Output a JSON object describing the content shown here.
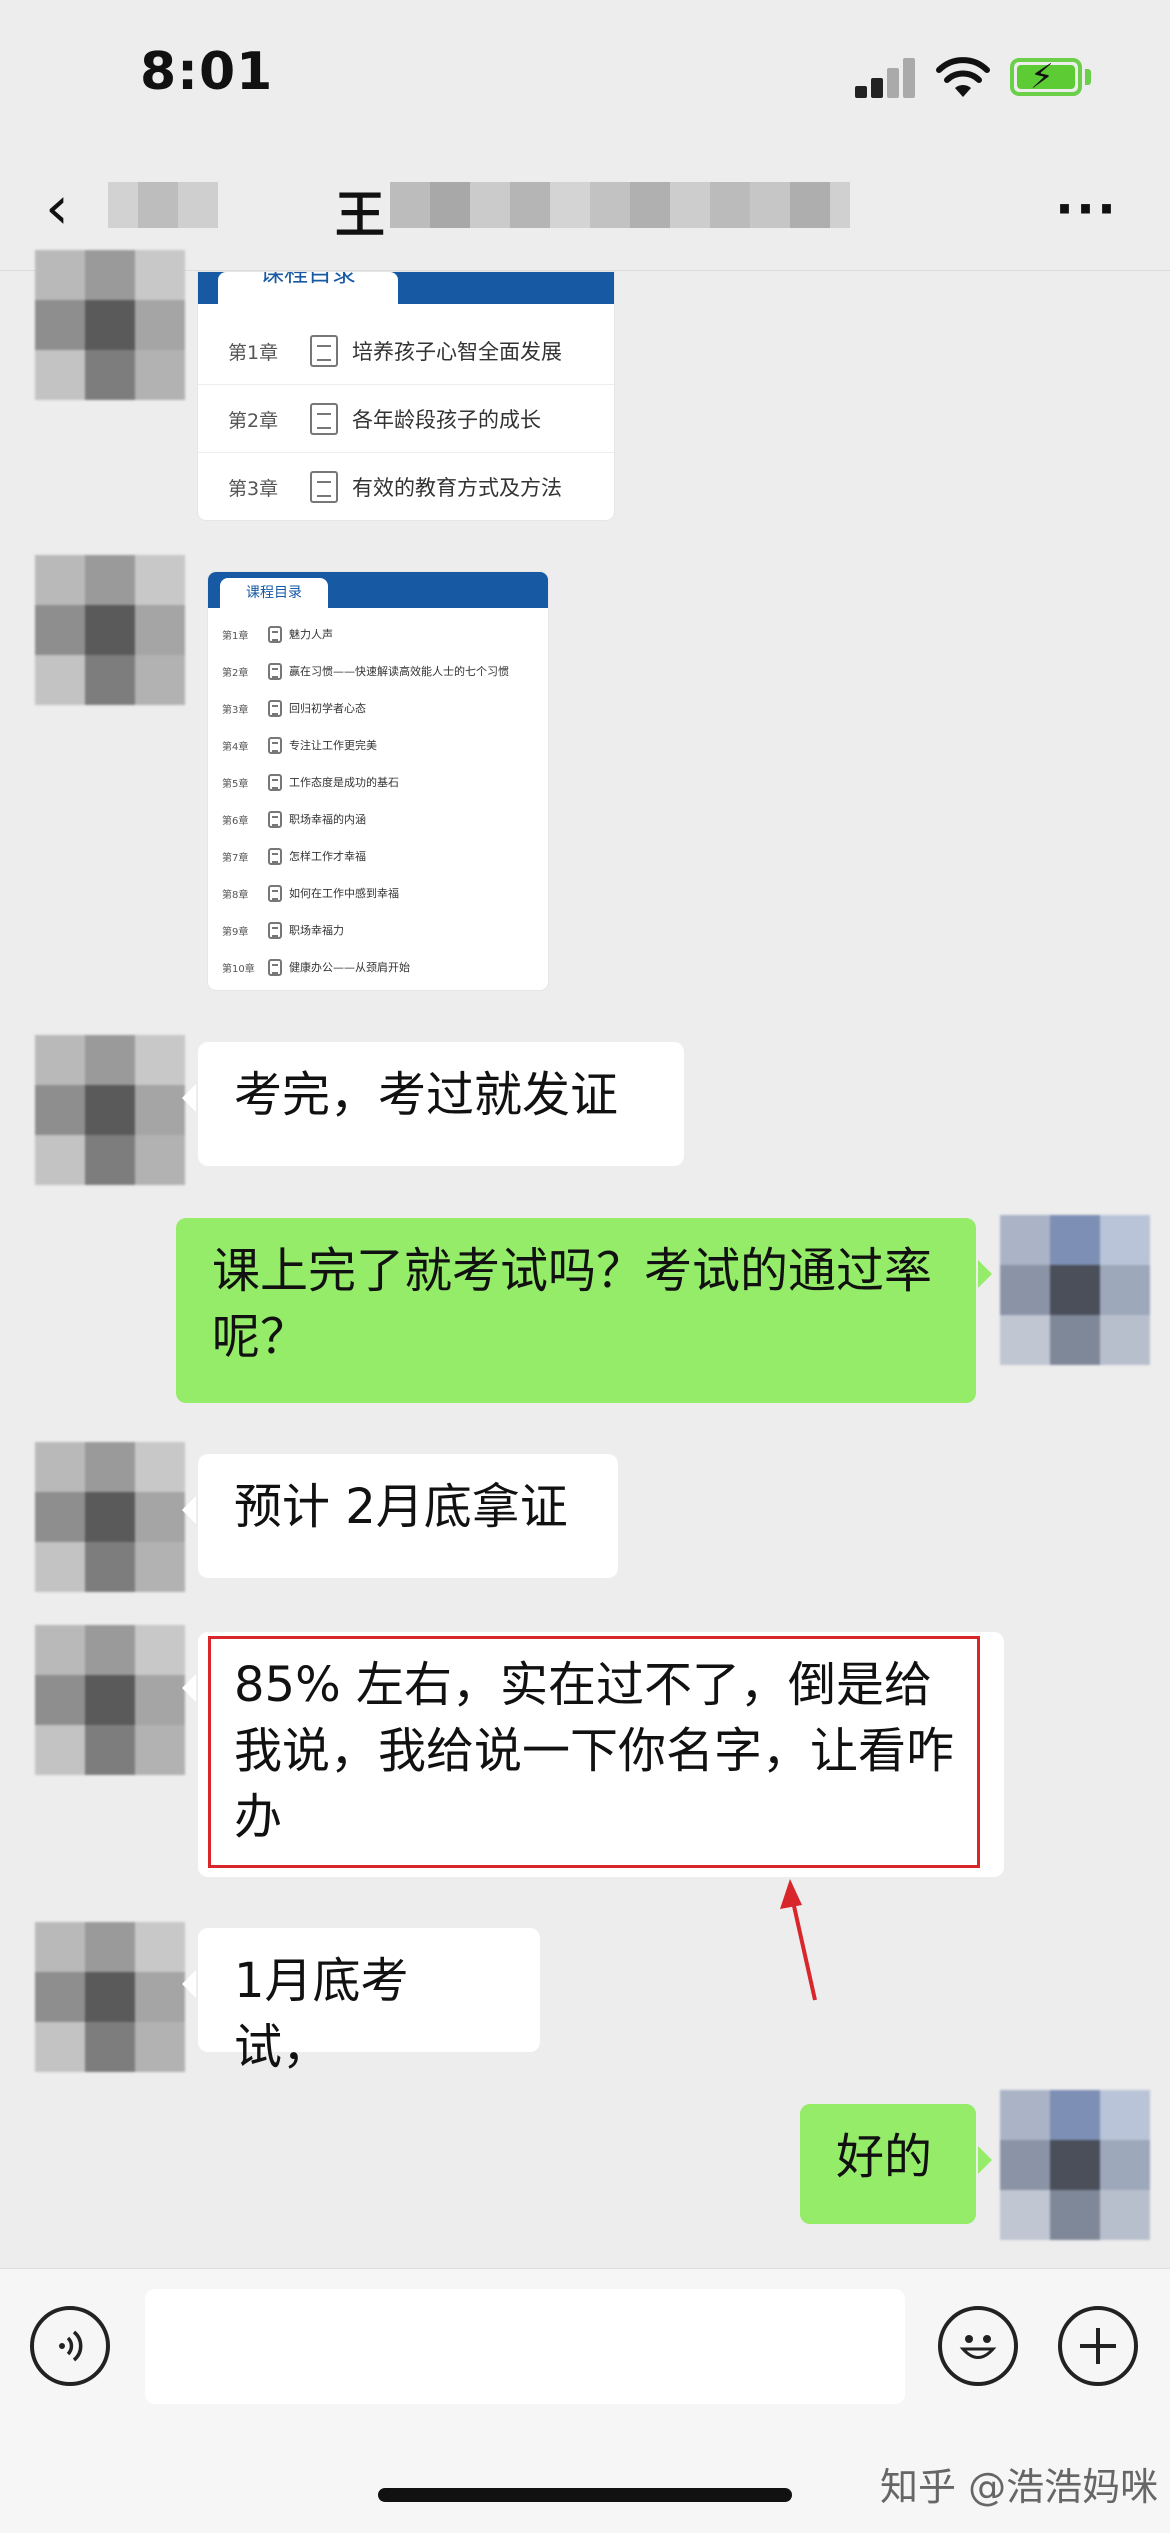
{
  "status_bar": {
    "time": "8:01"
  },
  "nav": {
    "back_icon": "chevron-left-icon",
    "title_visible": "王",
    "more_label": "···"
  },
  "messages": {
    "img1": {
      "header": "课程目录",
      "chapters": [
        {
          "num": "第1章",
          "title": "培养孩子心智全面发展"
        },
        {
          "num": "第2章",
          "title": "各年龄段孩子的成长"
        },
        {
          "num": "第3章",
          "title": "有效的教育方式及方法"
        }
      ]
    },
    "img2": {
      "header": "课程目录",
      "chapters": [
        {
          "num": "第1章",
          "title": "魅力人声"
        },
        {
          "num": "第2章",
          "title": "赢在习惯——快速解读高效能人士的七个习惯"
        },
        {
          "num": "第3章",
          "title": "回归初学者心态"
        },
        {
          "num": "第4章",
          "title": "专注让工作更完美"
        },
        {
          "num": "第5章",
          "title": "工作态度是成功的基石"
        },
        {
          "num": "第6章",
          "title": "职场幸福的内涵"
        },
        {
          "num": "第7章",
          "title": "怎样工作才幸福"
        },
        {
          "num": "第8章",
          "title": "如何在工作中感到幸福"
        },
        {
          "num": "第9章",
          "title": "职场幸福力"
        },
        {
          "num": "第10章",
          "title": "健康办公——从颈肩开始"
        }
      ]
    },
    "m1": "考完，考过就发证",
    "m2": "课上完了就考试吗？考试的通过率呢？",
    "m3": "预计 2月底拿证",
    "m4": "85% 左右，实在过不了，倒是给我说，我给说一下你名字，让看咋办",
    "m5": "1月底考试，",
    "m6": "好的"
  },
  "input_bar": {
    "voice_icon": "voice-icon",
    "emoji_icon": "emoji-icon",
    "plus_icon": "plus-icon"
  },
  "watermark": "知乎 @浩浩妈咪",
  "colors": {
    "sent_bubble": "#95ec69",
    "received_bubble": "#ffffff",
    "highlight": "#d9262a",
    "card_header": "#175aa3"
  }
}
